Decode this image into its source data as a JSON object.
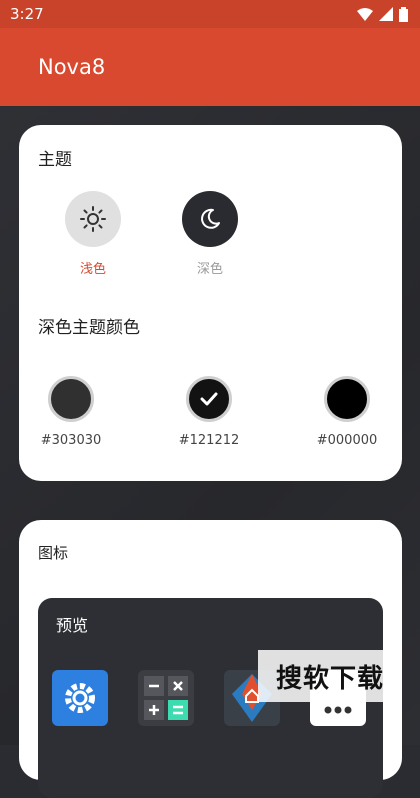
{
  "status": {
    "time": "3:27"
  },
  "appbar": {
    "title": "Nova8"
  },
  "theme_card": {
    "title": "主题",
    "light_label": "浅色",
    "dark_label": "深色",
    "dark_color_title": "深色主题颜色",
    "swatches": [
      {
        "label": "#303030",
        "color": "#303030",
        "selected": false
      },
      {
        "label": "#121212",
        "color": "#121212",
        "selected": true
      },
      {
        "label": "#000000",
        "color": "#000000",
        "selected": false
      }
    ],
    "accent": "#d8492f"
  },
  "icons_card": {
    "title": "图标",
    "preview_title": "预览",
    "preview_icons": [
      "settings-app-icon",
      "calculator-app-icon",
      "nova-launcher-app-icon",
      "messages-app-icon"
    ]
  },
  "watermark": "搜软下载"
}
